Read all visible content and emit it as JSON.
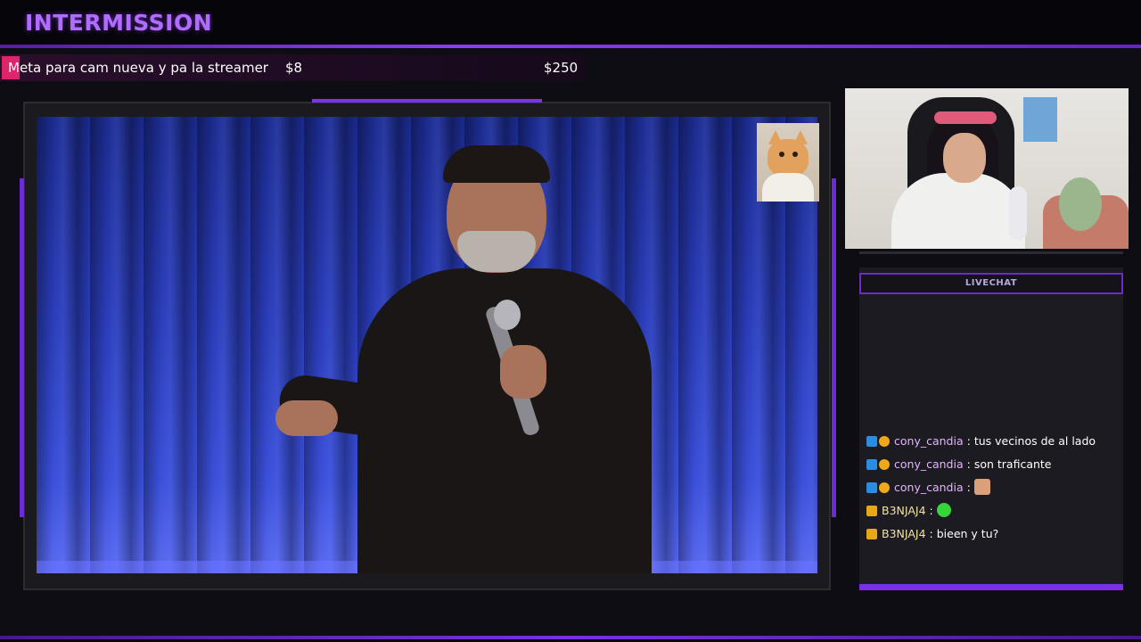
{
  "header": {
    "title": "INTERMISSION"
  },
  "goal": {
    "label": "Meta para cam nueva y pa la streamer",
    "current": "$8",
    "target": "$250",
    "progress_fraction": 0.032
  },
  "colors": {
    "accent": "#7a35e6",
    "title": "#b06bff",
    "goal_fill": "#e0246a",
    "chat_name_1": "#e4b3ff",
    "chat_name_2": "#f4e2a0"
  },
  "chat": {
    "header": "LIVECHAT",
    "messages": [
      {
        "user": "cony_candia",
        "separator": ":",
        "text": "tus vecinos de al lado",
        "badges": [
          "prime-icon",
          "bits-icon"
        ]
      },
      {
        "user": "cony_candia",
        "separator": ":",
        "text": "son traficante",
        "badges": [
          "prime-icon",
          "bits-icon"
        ]
      },
      {
        "user": "cony_candia",
        "separator": ":",
        "text": "",
        "emote": "face-emote",
        "badges": [
          "prime-icon",
          "bits-icon"
        ]
      },
      {
        "user": "B3NJAJ4",
        "separator": ":",
        "text": "",
        "emote": "green-blob-emote",
        "badges": [
          "crown-icon"
        ]
      },
      {
        "user": "B3NJAJ4",
        "separator": ":",
        "text": "bieen y tu?",
        "badges": [
          "crown-icon"
        ]
      }
    ]
  }
}
